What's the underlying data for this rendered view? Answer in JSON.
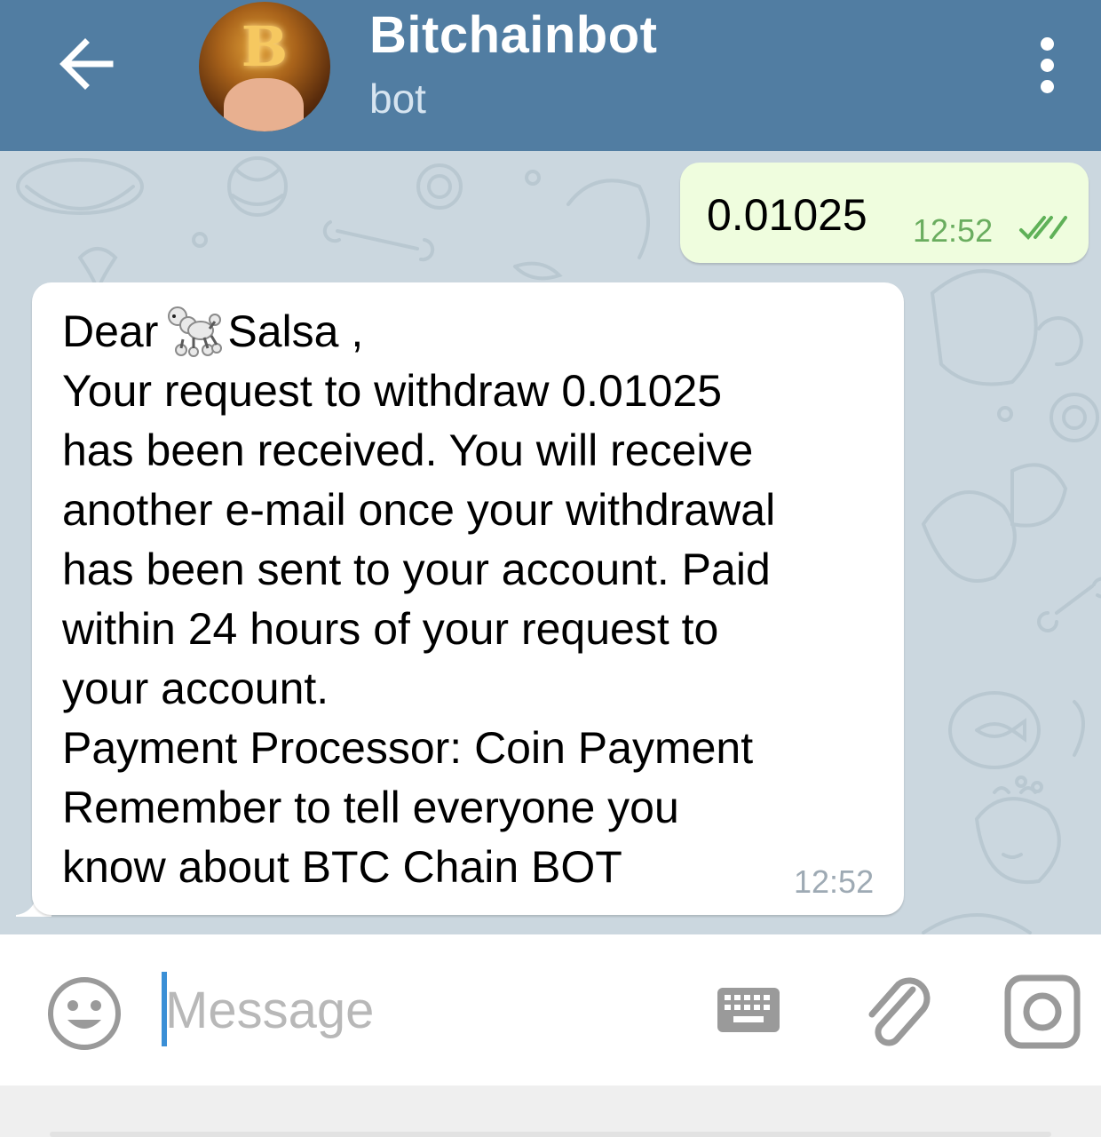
{
  "header": {
    "back_icon": "arrow-left-icon",
    "avatar_letter": "B",
    "title": "Bitchainbot",
    "subtitle": "bot",
    "menu_icon": "more-vertical-icon"
  },
  "messages": {
    "outgoing": {
      "text": "0.01025",
      "time": "12:52",
      "status_icon": "double-check-icon"
    },
    "incoming": {
      "lines": [
        "Dear",
        "Salsa ,",
        "Your request to withdraw 0.01025",
        "has been received. You will receive",
        "another e-mail once your withdrawal",
        "has been sent to your account. Paid",
        "within 24 hours of your request to",
        "your account.",
        "Payment Processor: Coin Payment",
        "Remember to tell everyone you",
        "know about BTC Chain BOT"
      ],
      "emoji": "poodle-icon",
      "time": "12:52"
    }
  },
  "input": {
    "placeholder": "Message",
    "value": "",
    "emoji_icon": "smiley-icon",
    "keyboard_icon": "keyboard-icon",
    "attach_icon": "paperclip-icon",
    "camera_icon": "camera-icon"
  },
  "colors": {
    "header": "#517da2",
    "chat_background": "#cbd7df",
    "outgoing_bubble": "#effdde",
    "incoming_bubble": "#ffffff",
    "outgoing_meta": "#6aad5f",
    "cursor": "#3a8fd6"
  }
}
